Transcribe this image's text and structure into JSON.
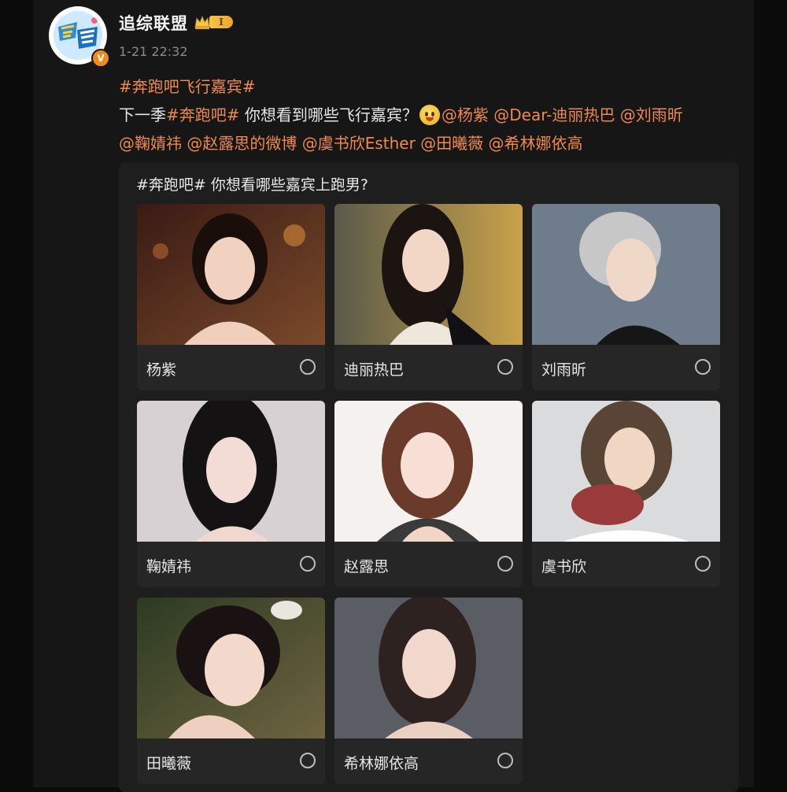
{
  "post": {
    "username": "追综联盟",
    "level": "I",
    "verified_mark": "V",
    "timestamp": "1-21 22:32",
    "line1": {
      "tag": "#奔跑吧飞行嘉宾#"
    },
    "line2": {
      "prefix": "下一季",
      "tag": "#奔跑吧#",
      "question": " 你想看到哪些飞行嘉宾？",
      "mentions": [
        "@杨紫",
        "@Dear-迪丽热巴",
        "@刘雨昕"
      ]
    },
    "line3": {
      "mentions": [
        "@鞠婧祎",
        "@赵露思的微博",
        "@虞书欣Esther",
        "@田曦薇",
        "@希林娜依高"
      ]
    }
  },
  "poll": {
    "title": "#奔跑吧# 你想看哪些嘉宾上跑男?",
    "options": [
      {
        "label": "杨紫"
      },
      {
        "label": "迪丽热巴"
      },
      {
        "label": "刘雨昕"
      },
      {
        "label": "鞠婧祎"
      },
      {
        "label": "赵露思"
      },
      {
        "label": "虞书欣"
      },
      {
        "label": "田曦薇"
      },
      {
        "label": "希林娜依高"
      }
    ]
  },
  "icons": {
    "crown": "crown-icon",
    "emoji": "smiling-face-emoji-icon",
    "radio": "radio-unselected-icon"
  },
  "colors": {
    "background": "#161616",
    "card": "#1e1e1e",
    "option": "#262626",
    "link": "#f08a4b",
    "verified": "#f08a1a",
    "badge": "#f5c64a"
  }
}
